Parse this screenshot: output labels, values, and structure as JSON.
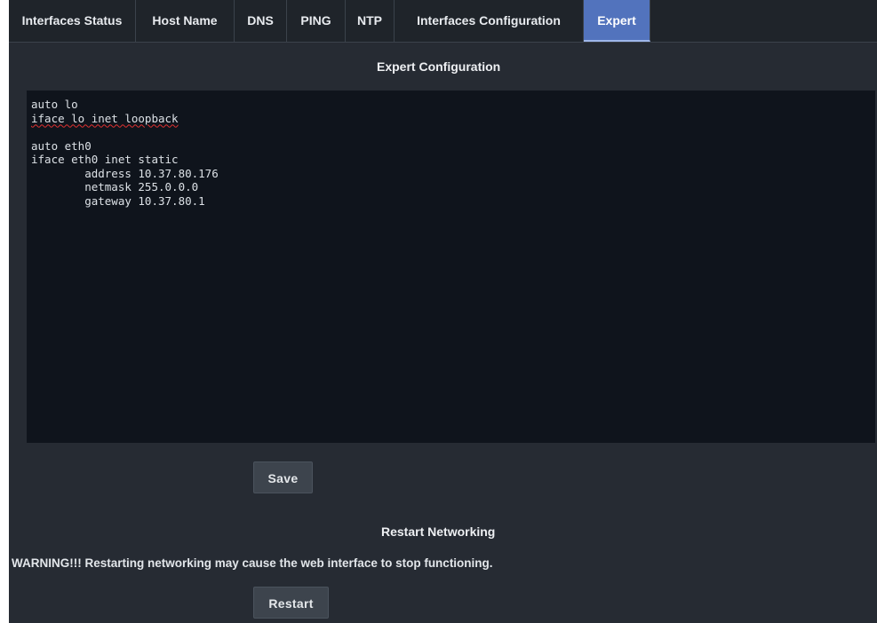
{
  "tabs": [
    {
      "label": "Interfaces Status"
    },
    {
      "label": "Host Name"
    },
    {
      "label": "DNS"
    },
    {
      "label": "PING"
    },
    {
      "label": "NTP"
    },
    {
      "label": "Interfaces Configuration"
    },
    {
      "label": "Expert",
      "active": true
    }
  ],
  "expert": {
    "title": "Expert Configuration",
    "config_lines": [
      "auto lo",
      "iface lo inet loopback",
      "",
      "auto eth0",
      "iface eth0 inet static",
      "        address 10.37.80.176",
      "        netmask 255.0.0.0",
      "        gateway 10.37.80.1"
    ],
    "save_label": "Save"
  },
  "restart": {
    "title": "Restart Networking",
    "warning": "WARNING!!! Restarting networking may cause the web interface to stop functioning.",
    "button_label": "Restart"
  },
  "colors": {
    "background": "#262b33",
    "tabbar": "#1f242a",
    "active_tab": "#5273bd",
    "editor_background": "#0f141c",
    "button": "#3d444d"
  }
}
